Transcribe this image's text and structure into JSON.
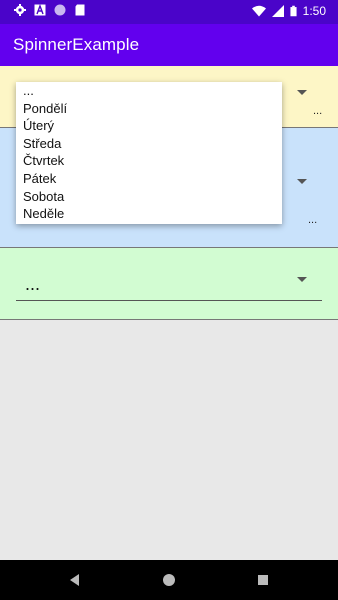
{
  "status_bar": {
    "time": "1:50",
    "icons": [
      "settings-icon",
      "text-icon",
      "circle-icon",
      "sd-card-icon",
      "wifi-icon",
      "signal-icon",
      "battery-icon"
    ],
    "bg_color": "#4a04c9"
  },
  "app_bar": {
    "title": "SpinnerExample",
    "bg_color": "#6200ee"
  },
  "spinners": {
    "yellow": {
      "value": "...",
      "bg_color": "#fdf6c6"
    },
    "blue": {
      "value": "...",
      "bg_color": "#c9e2fb"
    },
    "green": {
      "value": "...",
      "bg_color": "#d2fcd2"
    }
  },
  "dropdown": {
    "items": [
      "...",
      "Pondělí",
      "Úterý",
      "Středa",
      "Čtvrtek",
      "Pátek",
      "Sobota",
      "Neděle"
    ]
  },
  "nav_bar": {
    "icons": [
      "back-icon",
      "home-icon",
      "recents-icon"
    ]
  }
}
